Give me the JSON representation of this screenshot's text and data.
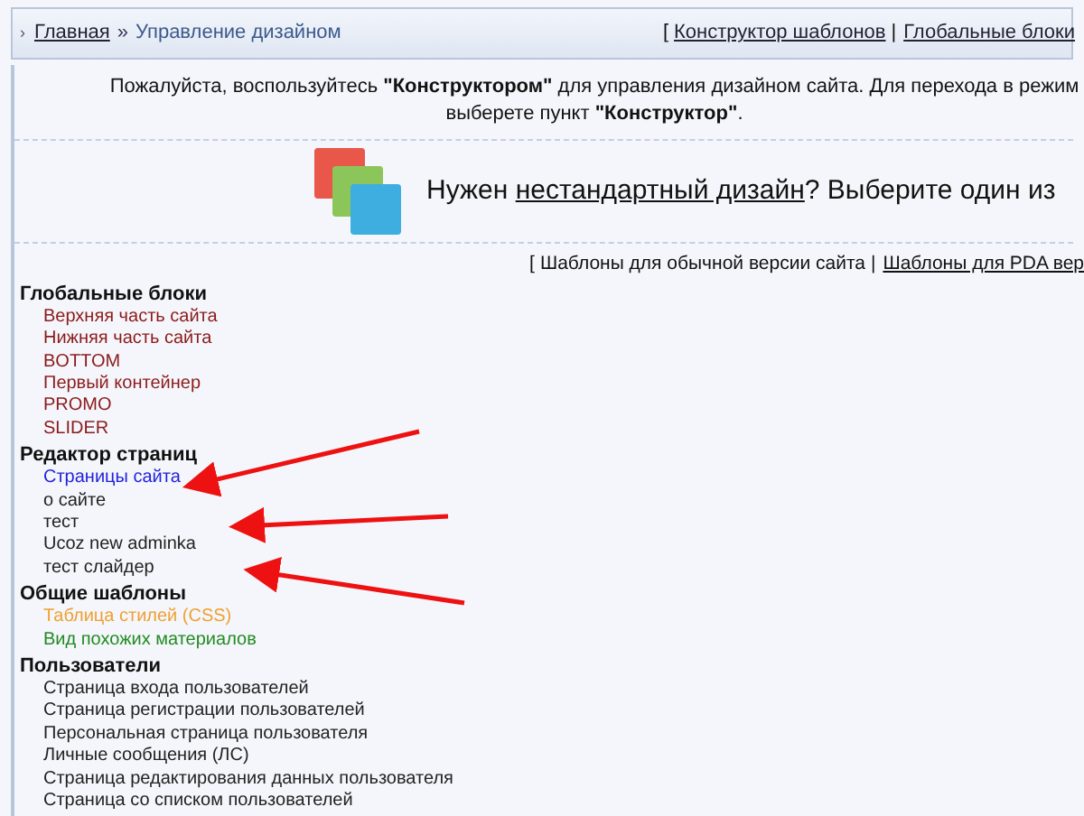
{
  "breadcrumb": {
    "marker": "›",
    "home": "Главная",
    "separator": "»",
    "current": "Управление дизайном"
  },
  "top_links": {
    "open": "[",
    "items": [
      "Конструктор шаблонов",
      "Глобальные блоки"
    ],
    "separator": "|"
  },
  "intro": {
    "lines": [
      "Пожалуйста, воспользуйтесь **\"Конструктором\"** для управления дизайном сайта. Для перехода в режим",
      "выберете пункт **\"Конструктор\"**."
    ]
  },
  "banner": {
    "before": "Нужен",
    "link": "нестандартный дизайн",
    "after": "? Выберите один из"
  },
  "template_links": {
    "open": "[",
    "items": [
      "Шаблоны для обычной версии сайта",
      "Шаблоны для PDA вер"
    ],
    "separator": "|"
  },
  "sections": [
    {
      "title": "Глобальные блоки",
      "items": [
        {
          "label": "Верхняя часть сайта",
          "color": "#8b1a1a"
        },
        {
          "label": "Нижняя часть сайта",
          "color": "#8b1a1a"
        },
        {
          "label": "BOTTOM",
          "color": "#8b1a1a"
        },
        {
          "label": "Первый контейнер",
          "color": "#8b1a1a"
        },
        {
          "label": "PROMO",
          "color": "#8b1a1a"
        },
        {
          "label": "SLIDER",
          "color": "#8b1a1a"
        }
      ]
    },
    {
      "title": "Редактор страниц",
      "items": [
        {
          "label": "Страницы сайта",
          "color": "#2222dd"
        },
        {
          "label": "о сайте",
          "color": "#222222"
        },
        {
          "label": "тест",
          "color": "#222222"
        },
        {
          "label": "Ucoz new adminka",
          "color": "#222222"
        },
        {
          "label": "тест слайдер",
          "color": "#222222"
        }
      ]
    },
    {
      "title": "Общие шаблоны",
      "items": [
        {
          "label": "Таблица стилей (CSS)",
          "color": "#f0a030"
        },
        {
          "label": "Вид похожих материалов",
          "color": "#228b22"
        }
      ]
    },
    {
      "title": "Пользователи",
      "items": [
        {
          "label": "Страница входа пользователей",
          "color": "#222222"
        },
        {
          "label": "Страница регистрации пользователей",
          "color": "#222222"
        },
        {
          "label": "Персональная страница пользователя",
          "color": "#222222"
        },
        {
          "label": "Личные сообщения (ЛС)",
          "color": "#222222"
        },
        {
          "label": "Страница редактирования данных пользователя",
          "color": "#222222"
        },
        {
          "label": "Страница со списком пользователей",
          "color": "#222222"
        }
      ]
    }
  ]
}
